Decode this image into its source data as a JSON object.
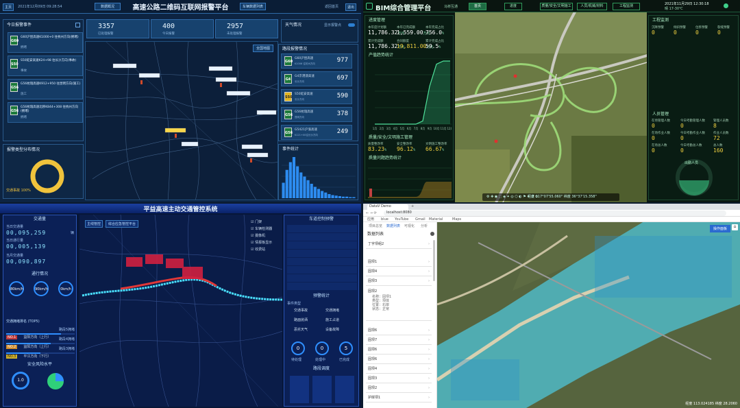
{
  "q1": {
    "title": "高速公路二维码互联网报警平台",
    "datetime": "2021年12月09日 09:28:54",
    "left_btn": "主页",
    "tab_left": "数据概况",
    "tab_right": "车辆数据列表",
    "right_link": "返回首页",
    "right_btn": "退出",
    "panel_events_title": "今日报警事件",
    "events": [
      {
        "code": "G60",
        "text": "G60沪昆高速K1000+0 往杭州方向(拥堵)",
        "sub": "拥堵"
      },
      {
        "code": "S50",
        "text": "S50延安高速K24+98 往长沙方向(事故)",
        "sub": "事故"
      },
      {
        "code": "G56",
        "text": "G56杭瑞高速K912+950 往昆明方向(施工)",
        "sub": "施工"
      },
      {
        "code": "G56",
        "text": "G56杭瑞高速北移K844+308 往杭州方向(拥堵)",
        "sub": "拥堵"
      }
    ],
    "panel_dist_title": "报警类型分布情况",
    "donut_label": "交通事故 100%",
    "stats": [
      {
        "value": "3357",
        "label": "已处理报警"
      },
      {
        "value": "400",
        "label": "今日报警"
      },
      {
        "value": "2957",
        "label": "未处理报警"
      }
    ],
    "map_tag": "全国地图",
    "weather_title": "天气情况",
    "weather_toggle": "显示报警点",
    "roads_title": "路段报警情况",
    "roads": [
      {
        "code": "G60",
        "name": "G60沪昆高速",
        "sub": "K1006 往杭州方向",
        "value": "977"
      },
      {
        "code": "G4",
        "name": "G4京港澳高速",
        "sub": "长沙方向",
        "value": "697"
      },
      {
        "code": "S50",
        "name": "S50延安高速",
        "sub": "长沙方向",
        "value": "590"
      },
      {
        "code": "G56",
        "name": "G56杭瑞高速",
        "sub": "昆明方向",
        "value": "378"
      },
      {
        "code": "G56",
        "name": "G5421沪渝高速",
        "sub": "K121+00往长沙方向",
        "value": "249"
      }
    ],
    "hist_title": "事件统计"
  },
  "q1_chart": {
    "type": "bar",
    "values": [
      30,
      55,
      70,
      80,
      62,
      50,
      42,
      35,
      28,
      22,
      18,
      14,
      11,
      8,
      6,
      5,
      4,
      3,
      3,
      2,
      2
    ]
  },
  "q2": {
    "title": "BIM综合管理平台",
    "org": "马桥互通",
    "tabs": [
      "首页",
      "进度",
      "质量/安全/文明施工",
      "人员/机械/材料",
      "工程监测"
    ],
    "datetime": "2021年11月29日 12:30:18",
    "weather": "晴 17-30℃",
    "progress_title": "进度管理",
    "progress_items": [
      {
        "label": "本年度计划额",
        "value": "11,786.32",
        "unit": "万元"
      },
      {
        "label": "本年已完成额",
        "value": "1,559.00",
        "unit": "万元"
      },
      {
        "label": "本年完成占比",
        "value": "756.0",
        "unit": "%"
      },
      {
        "label": "累计完成额",
        "value": "11,786.32",
        "unit": "万元"
      },
      {
        "label": "合同额度",
        "value": "19,811.00",
        "unit": "万元"
      },
      {
        "label": "累计完成占比",
        "value": "59.5",
        "unit": "%"
      }
    ],
    "chart_title": "产值趋势统计",
    "quality_title": "质量/安全/文明施工管理",
    "quality_items": [
      {
        "label": "质量整改率",
        "value": "83.23",
        "unit": "%"
      },
      {
        "label": "安全整改率",
        "value": "96.12",
        "unit": "%"
      },
      {
        "label": "文明施工整改率",
        "value": "66.67",
        "unit": "%"
      }
    ],
    "q_chart_title": "质量问题趋势统计",
    "eng_title": "工程监测",
    "eng_items": [
      {
        "label": "沉降预警",
        "value": "0"
      },
      {
        "label": "倾斜预警",
        "value": "0"
      },
      {
        "label": "位移预警",
        "value": "0"
      },
      {
        "label": "裂缝预警",
        "value": "0"
      }
    ],
    "person_title": "人员管理",
    "person_items": [
      {
        "label": "在场管理人数",
        "value": "0"
      },
      {
        "label": "今日考勤管理人数",
        "value": "0"
      },
      {
        "label": "管理人员数",
        "value": "8"
      },
      {
        "label": "在场作业人数",
        "value": "0"
      },
      {
        "label": "今日考勤作业人数",
        "value": "0"
      },
      {
        "label": "作业人员数",
        "value": "72"
      },
      {
        "label": "在场总人数",
        "value": "0"
      },
      {
        "label": "今日考勤总人数",
        "value": "0"
      },
      {
        "label": "总人数",
        "value": "160"
      }
    ],
    "gauge_label": "出勤人员",
    "coords": "经度 117°07'55.060\"  纬度 36°37'15.358\""
  },
  "q2_chart": {
    "type": "area",
    "x": [
      "1月",
      "2月",
      "3月",
      "4月",
      "5月",
      "6月",
      "7月",
      "8月",
      "9月",
      "10月",
      "11月",
      "12月"
    ],
    "values": [
      0,
      0,
      0,
      0,
      0,
      0,
      0,
      5,
      60,
      95,
      100,
      100
    ]
  },
  "q3": {
    "title": "平益高速主动交通管控系统",
    "flow_title": "交通量",
    "flow_rows": [
      {
        "label": "当日交通量",
        "digits": "00,095,259"
      },
      {
        "label": "当日通行量",
        "digits": "00,005,139"
      },
      {
        "label": "当月交通量",
        "digits": "00,090,897"
      }
    ],
    "unit": "辆",
    "op_title": "通行情况",
    "gauges": [
      "80km/h",
      "90km/h",
      "0km/h"
    ],
    "rank_title": "交通拥堵排名 (TOP5)",
    "ranks": [
      {
        "no": "NO.1",
        "name": "益阳方向（上行）",
        "value": "路段5拥堵"
      },
      {
        "no": "NO.2",
        "name": "益阳方向（上行）",
        "value": "路段4拥堵"
      },
      {
        "no": "NO.3",
        "name": "平江方向（下行）",
        "value": "路段3拥堵"
      }
    ],
    "safety_title": "安全风险水平",
    "safety_value": "1.0",
    "map_btn1": "主线管控",
    "map_btn2": "综合应急管控平台",
    "legend": [
      "门架",
      "车辆检测器",
      "摄像机",
      "情报板显示",
      "收费站"
    ],
    "right_title1": "车道控制预警",
    "right_title2": "预警统计",
    "event_title": "事件类型",
    "events": [
      "交通事故",
      "交通拥堵",
      "路面抛洒",
      "施工占道",
      "恶劣天气",
      "设备故障"
    ],
    "counts": [
      {
        "value": "0",
        "label": "待处理"
      },
      {
        "value": "0",
        "label": "处理中"
      },
      {
        "value": "5",
        "label": "已完成"
      }
    ],
    "bottom_title": "路段调度"
  },
  "q4": {
    "tab_title": "DataV Demo",
    "url": "localhost:8080",
    "bookmarks": [
      "应用",
      "blue",
      "YouTube",
      "Gmail",
      "Material",
      "Maps"
    ],
    "sub_tabs": [
      "项目总览",
      "数据列表",
      "可视化",
      "分析"
    ],
    "panel_title": "数据列表",
    "list": [
      "丁字坝组2",
      "固坝1",
      "固坝4",
      "固坝3",
      "固坝2",
      "固坝6",
      "固坝7",
      "固坝6",
      "固坝6",
      "固坝4",
      "固坝3",
      "固坝2",
      "固坝1",
      "固坝4",
      "固坝5",
      "护岸坝1"
    ],
    "detail": [
      "名称：固坝1",
      "类型：坝体",
      "位置：右岸",
      "状态：正常"
    ],
    "top_right_btn": "操作面板",
    "status": "经度 113.024185  纬度 28.2060"
  }
}
